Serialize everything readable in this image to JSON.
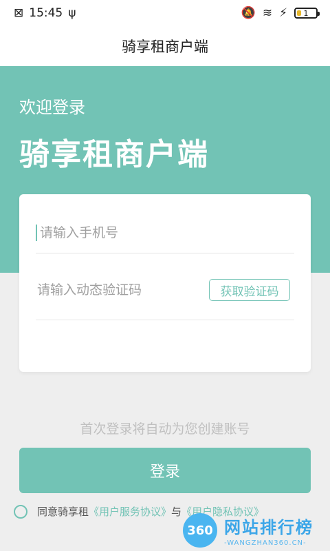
{
  "status_bar": {
    "notification_icon": "notification-icon",
    "time": "15:45",
    "usb_icon": "usb-icon",
    "mute_icon": "bell-off-icon",
    "wifi_icon": "wifi-icon",
    "charging_icon": "bolt-icon",
    "battery_level": "1"
  },
  "title_bar": {
    "title": "骑享租商户端"
  },
  "hero": {
    "welcome": "欢迎登录",
    "title": "骑享租商户端",
    "color": "#72c3b5"
  },
  "form": {
    "phone_placeholder": "请输入手机号",
    "code_placeholder": "请输入动态验证码",
    "code_button": "获取验证码"
  },
  "auto_register_note": "首次登录将自动为您创建账号",
  "login_button": "登录",
  "agreement": {
    "prefix": "同意骑享租",
    "terms_link": "《用户服务协议》",
    "connector": "与",
    "privacy_link": "《用户隐私协议》"
  },
  "watermark": {
    "logo": "360",
    "text": "网站排行榜",
    "subtext": "-WANGZHAN360.CN-"
  }
}
